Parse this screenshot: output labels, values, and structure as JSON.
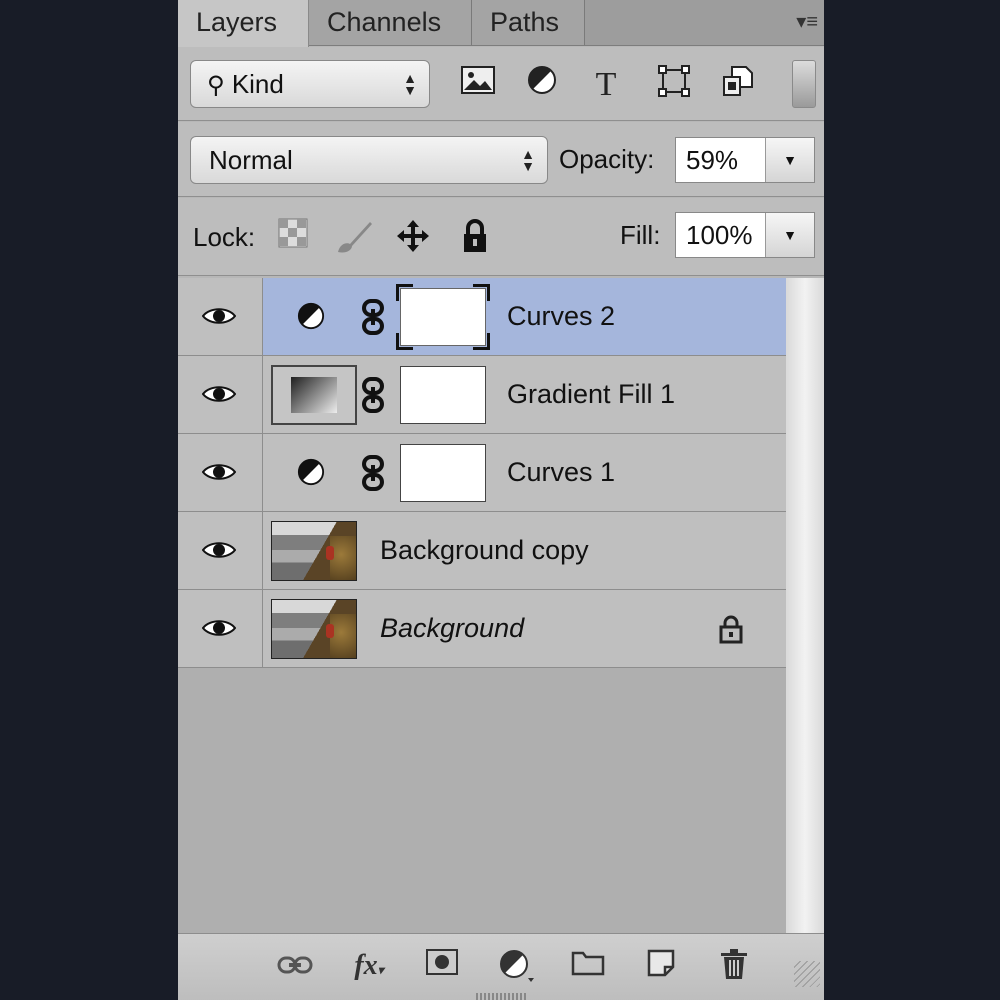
{
  "tabs": [
    {
      "label": "Layers",
      "active": true
    },
    {
      "label": "Channels",
      "active": false
    },
    {
      "label": "Paths",
      "active": false
    }
  ],
  "filter": {
    "kind_label": "Kind",
    "tool_icons": [
      "image-filter-icon",
      "adjustment-filter-icon",
      "type-filter-icon",
      "shape-filter-icon",
      "smart-object-filter-icon"
    ]
  },
  "blend": {
    "mode": "Normal",
    "opacity_label": "Opacity:",
    "opacity_value": "59%"
  },
  "lock": {
    "label": "Lock:",
    "fill_label": "Fill:",
    "fill_value": "100%"
  },
  "layers": [
    {
      "name": "Curves 2",
      "kind": "adjustment",
      "selected": true,
      "locked": false
    },
    {
      "name": "Gradient Fill 1",
      "kind": "gradient",
      "selected": false,
      "locked": false
    },
    {
      "name": "Curves 1",
      "kind": "adjustment",
      "selected": false,
      "locked": false
    },
    {
      "name": "Background copy",
      "kind": "pixel",
      "selected": false,
      "locked": false
    },
    {
      "name": "Background",
      "kind": "pixel",
      "selected": false,
      "locked": true
    }
  ],
  "bottom_icons": [
    "link-layers-icon",
    "fx-icon",
    "add-mask-icon",
    "new-adjustment-icon",
    "new-group-icon",
    "new-layer-icon",
    "trash-icon"
  ],
  "colors": {
    "selection": "#a5b6dc",
    "panel": "#b7b7b7",
    "background": "#181c27"
  }
}
